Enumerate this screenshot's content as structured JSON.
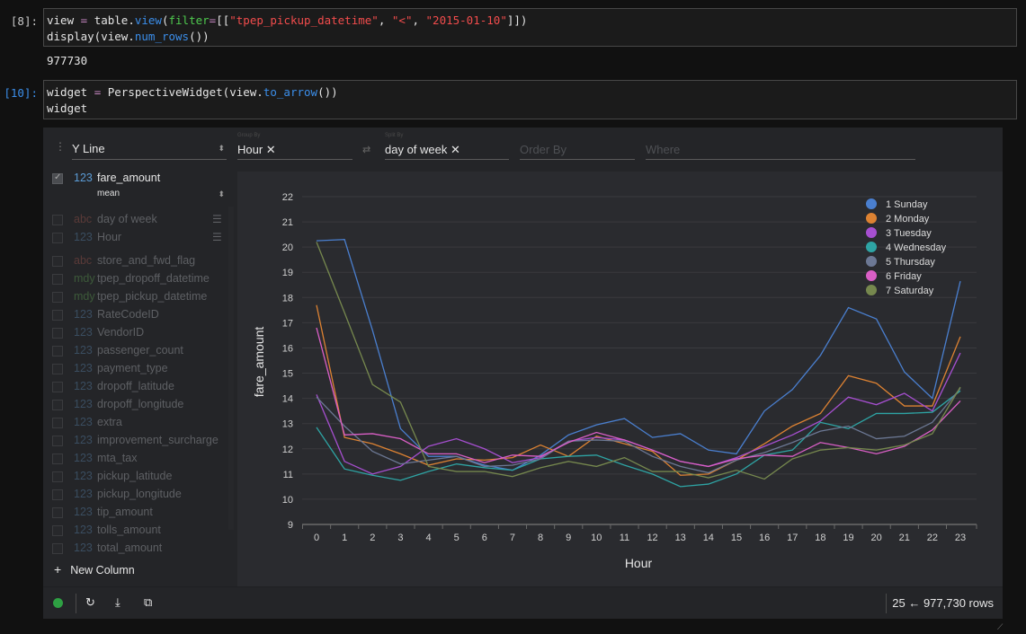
{
  "notebook": {
    "cell8": {
      "prompt": "[8]:",
      "line1": {
        "a": "view ",
        "op": "=",
        "b": " table.",
        "fn": "view",
        "c": "(",
        "kw": "filter",
        "op2": "=",
        "d": "[[",
        "s1": "\"tpep_pickup_datetime\"",
        "e": ", ",
        "s2": "\"<\"",
        "f": ", ",
        "s3": "\"2015-01-10\"",
        "g": "]])"
      },
      "line2": {
        "a": "display(view.",
        "fn": "num_rows",
        "b": "())"
      },
      "output": "977730"
    },
    "cell10": {
      "prompt": "[10]:",
      "line1": {
        "a": "widget ",
        "op": "=",
        "b": " PerspectiveWidget(view.",
        "fn": "to_arrow",
        "c": "())"
      },
      "line2": "widget"
    }
  },
  "widget": {
    "plugin": "Y Line",
    "group_by": {
      "label": "Group By",
      "value": "Hour ✕"
    },
    "split_by": {
      "label": "Split By",
      "value": "day of week ✕"
    },
    "order_by": {
      "placeholder": "Order By"
    },
    "where": {
      "placeholder": "Where"
    },
    "swap_icon": "⇄",
    "active_column": {
      "type": "123",
      "name": "fare_amount",
      "aggregate": "mean"
    },
    "pivot_columns": [
      {
        "type": "abc",
        "name": "day of week"
      },
      {
        "type": "123",
        "name": "Hour"
      }
    ],
    "columns": [
      {
        "type": "abc",
        "name": "store_and_fwd_flag"
      },
      {
        "type": "mdy",
        "name": "tpep_dropoff_datetime"
      },
      {
        "type": "mdy",
        "name": "tpep_pickup_datetime"
      },
      {
        "type": "123",
        "name": "RateCodeID"
      },
      {
        "type": "123",
        "name": "VendorID"
      },
      {
        "type": "123",
        "name": "passenger_count"
      },
      {
        "type": "123",
        "name": "payment_type"
      },
      {
        "type": "123",
        "name": "dropoff_latitude"
      },
      {
        "type": "123",
        "name": "dropoff_longitude"
      },
      {
        "type": "123",
        "name": "extra"
      },
      {
        "type": "123",
        "name": "improvement_surcharge"
      },
      {
        "type": "123",
        "name": "mta_tax"
      },
      {
        "type": "123",
        "name": "pickup_latitude"
      },
      {
        "type": "123",
        "name": "pickup_longitude"
      },
      {
        "type": "123",
        "name": "tip_amount"
      },
      {
        "type": "123",
        "name": "tolls_amount"
      },
      {
        "type": "123",
        "name": "total_amount"
      }
    ],
    "new_column": "New Column",
    "row_count": "25 ← 977,730 rows",
    "status_color": "#2ea043"
  },
  "chart_data": {
    "type": "line",
    "title": "",
    "xlabel": "Hour",
    "ylabel": "fare_amount",
    "ylim": [
      9,
      22
    ],
    "yticks": [
      9,
      10,
      11,
      12,
      13,
      14,
      15,
      16,
      17,
      18,
      19,
      20,
      21,
      22
    ],
    "x": [
      0,
      1,
      2,
      3,
      4,
      5,
      6,
      7,
      8,
      9,
      10,
      11,
      12,
      13,
      14,
      15,
      16,
      17,
      18,
      19,
      20,
      21,
      22,
      23
    ],
    "grid": true,
    "legend": "top-right",
    "series": [
      {
        "name": "1 Sunday",
        "color": "#4a7fcf",
        "values": [
          20.25,
          20.3,
          16.7,
          12.8,
          11.7,
          11.7,
          11.35,
          11.15,
          11.75,
          12.55,
          12.95,
          13.2,
          12.45,
          12.6,
          11.95,
          11.8,
          13.5,
          14.35,
          15.7,
          17.6,
          17.15,
          15.05,
          14.0,
          18.65
        ]
      },
      {
        "name": "2 Monday",
        "color": "#dd8232",
        "values": [
          17.7,
          12.45,
          12.2,
          11.8,
          11.35,
          11.6,
          11.55,
          11.65,
          12.15,
          11.7,
          12.5,
          12.2,
          11.9,
          10.95,
          11.0,
          11.55,
          12.2,
          12.9,
          13.4,
          14.9,
          14.6,
          13.7,
          13.7,
          16.45
        ]
      },
      {
        "name": "3 Tuesday",
        "color": "#a64fd0",
        "values": [
          14.15,
          11.5,
          11.0,
          11.3,
          12.1,
          12.4,
          12.0,
          11.45,
          11.65,
          12.3,
          12.45,
          12.35,
          11.95,
          11.5,
          11.3,
          11.65,
          12.1,
          12.55,
          13.1,
          14.05,
          13.75,
          14.2,
          13.5,
          15.8
        ]
      },
      {
        "name": "4 Wednesday",
        "color": "#2ea4a4",
        "values": [
          12.85,
          11.2,
          10.95,
          10.75,
          11.1,
          11.4,
          11.25,
          11.15,
          11.6,
          11.7,
          11.75,
          11.35,
          11.0,
          10.5,
          10.6,
          11.0,
          11.75,
          11.95,
          13.05,
          12.8,
          13.4,
          13.4,
          13.45,
          14.3
        ]
      },
      {
        "name": "5 Thursday",
        "color": "#6c7894",
        "values": [
          14.05,
          12.9,
          11.9,
          11.4,
          11.55,
          11.7,
          11.3,
          11.35,
          11.6,
          12.3,
          12.35,
          12.3,
          11.7,
          11.3,
          11.05,
          11.55,
          11.85,
          12.25,
          12.7,
          12.9,
          12.4,
          12.5,
          13.05,
          14.4
        ]
      },
      {
        "name": "6 Friday",
        "color": "#da5fc6",
        "values": [
          16.8,
          12.55,
          12.6,
          12.4,
          11.8,
          11.8,
          11.45,
          11.75,
          11.7,
          12.25,
          12.65,
          12.35,
          11.95,
          11.5,
          11.3,
          11.6,
          11.75,
          11.7,
          12.25,
          12.05,
          11.8,
          12.1,
          12.75,
          13.9
        ]
      },
      {
        "name": "7 Saturday",
        "color": "#76884e",
        "values": [
          20.2,
          17.4,
          14.55,
          13.85,
          11.3,
          11.1,
          11.1,
          10.9,
          11.25,
          11.5,
          11.3,
          11.65,
          11.1,
          11.1,
          10.85,
          11.15,
          10.8,
          11.6,
          11.95,
          12.05,
          11.95,
          12.15,
          12.6,
          14.45
        ]
      }
    ]
  }
}
